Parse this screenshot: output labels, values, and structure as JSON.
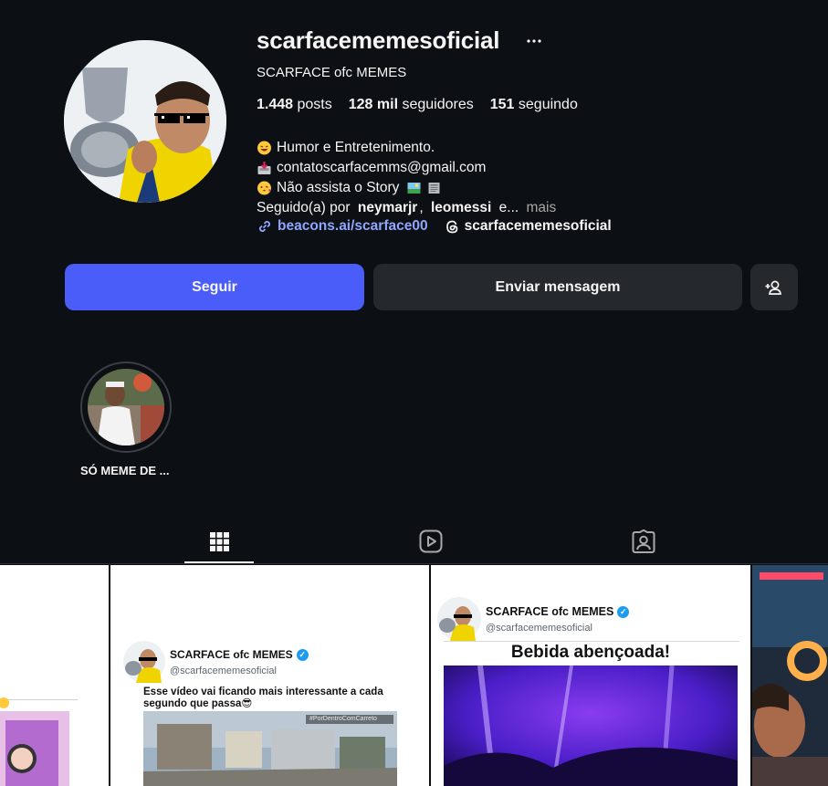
{
  "profile": {
    "username": "scarfacememesoficial",
    "full_name": "SCARFACE ofc MEMES",
    "stats": {
      "posts_value": "1.448",
      "posts_label": "posts",
      "followers_value": "128 mil",
      "followers_label": "seguidores",
      "following_value": "151",
      "following_label": "seguindo"
    },
    "bio": {
      "line1": "Humor e Entretenimento.",
      "line2": "contatoscarfacemms@gmail.com",
      "line3": "Não assista o Story",
      "followed_prefix": "Seguido(a) por",
      "followed_user1": "neymarjr",
      "followed_sep": ",",
      "followed_user2": "leomessi",
      "followed_suffix": "e...",
      "more": "mais"
    },
    "link": "beacons.ai/scarface00",
    "threads": "scarfacememesoficial"
  },
  "actions": {
    "follow": "Seguir",
    "message": "Enviar mensagem"
  },
  "highlights": [
    {
      "label": "SÓ MEME DE ..."
    }
  ],
  "tabs": [
    {
      "icon": "grid-icon",
      "active": true
    },
    {
      "icon": "reels-icon",
      "active": false
    },
    {
      "icon": "tagged-icon",
      "active": false
    }
  ],
  "posts": {
    "post2": {
      "name": "SCARFACE ofc MEMES",
      "handle": "@scarfacememesoficial",
      "text": "Esse vídeo vai ficando mais interessante a cada segundo que passa😎",
      "watermark": "#PorDentroComCarreto"
    },
    "post3": {
      "name": "SCARFACE ofc MEMES",
      "handle": "@scarfacememesoficial",
      "caption": "Bebida abençoada!"
    }
  },
  "colors": {
    "background": "#0c0f14",
    "follow_button": "#4a5df9",
    "secondary_button": "#25292e",
    "link": "#8fa6ff",
    "verified": "#1d9bf0"
  }
}
